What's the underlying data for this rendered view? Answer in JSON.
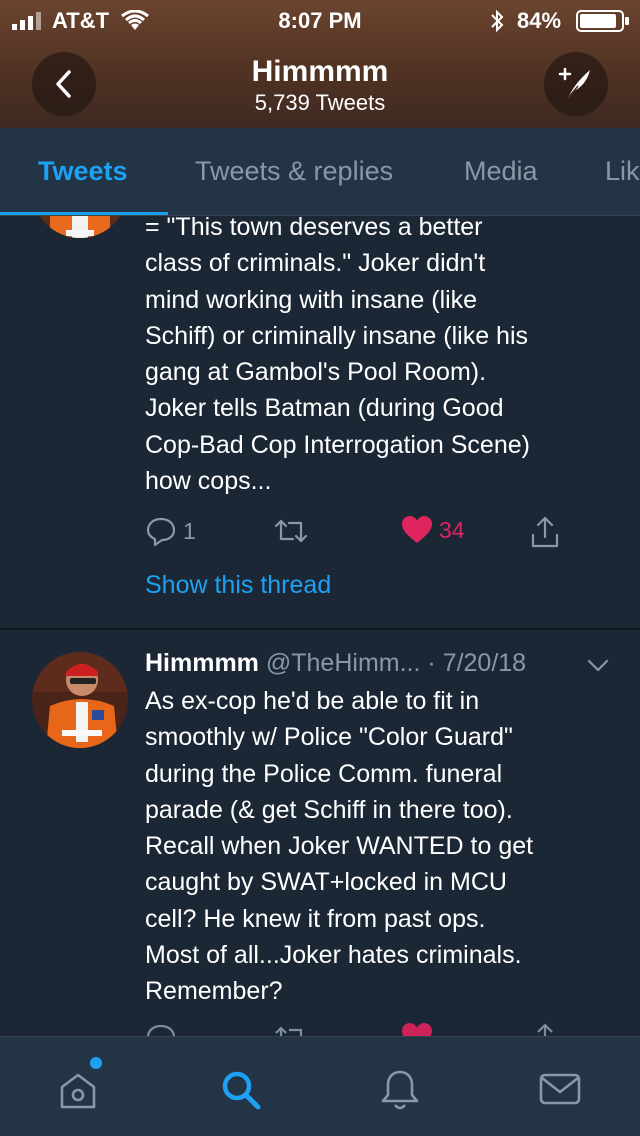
{
  "status_bar": {
    "carrier": "AT&T",
    "time": "8:07 PM",
    "battery": "84%",
    "icons": [
      "signal-icon",
      "wifi-icon",
      "bluetooth-icon",
      "battery-icon"
    ]
  },
  "header": {
    "title": "Himmmm",
    "subtitle": "5,739 Tweets",
    "icons": [
      "back-arrow-icon",
      "compose-tweet-icon"
    ]
  },
  "tabs": [
    {
      "label": "Tweets",
      "active": true
    },
    {
      "label": "Tweets & replies",
      "active": false
    },
    {
      "label": "Media",
      "active": false
    },
    {
      "label": "Lik",
      "active": false
    }
  ],
  "tweets": [
    {
      "text": "= \"This town deserves a better\nclass of criminals.\" Joker didn't\nmind working with insane (like\nSchiff) or criminally insane (like his\ngang at Gambol's Pool Room).\nJoker tells Batman (during Good\nCop-Bad Cop Interrogation Scene)\nhow cops...",
      "replies": "1",
      "retweets": "",
      "likes": "34",
      "liked": true,
      "show_thread": "Show this thread"
    },
    {
      "name": "Himmmm",
      "handle": "@TheHimm...",
      "date": "· 7/20/18",
      "text": "As ex-cop he'd be able to fit in\nsmoothly w/ Police \"Color Guard\"\nduring the Police Comm. funeral\nparade (& get Schiff in there too).\nRecall when Joker WANTED to get\ncaught by SWAT+locked in MCU\ncell? He knew it from past ops.\nMost of all...Joker hates criminals.\nRemember?"
    }
  ],
  "bottom_nav": [
    {
      "icon": "home-icon",
      "active": false,
      "has_dot": true
    },
    {
      "icon": "search-icon",
      "active": true
    },
    {
      "icon": "notifications-bell-icon",
      "active": false
    },
    {
      "icon": "messages-envelope-icon",
      "active": false
    }
  ],
  "colors": {
    "background": "#1c2735",
    "accent": "#1da1f2",
    "like": "#e0245e",
    "muted": "#8899a6",
    "header_brown": "#5a3826"
  }
}
